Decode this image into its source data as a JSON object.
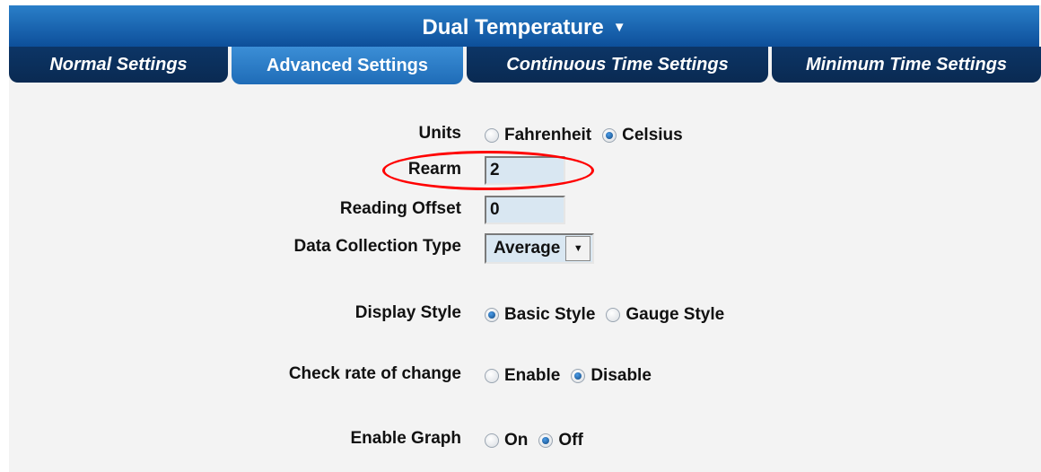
{
  "header": {
    "title": "Dual Temperature",
    "caret": "▼"
  },
  "tabs": [
    {
      "label": "Normal Settings"
    },
    {
      "label": "Advanced Settings"
    },
    {
      "label": "Continuous Time Settings"
    },
    {
      "label": "Minimum Time Settings"
    }
  ],
  "active_tab": "Advanced Settings",
  "form": {
    "units": {
      "label": "Units",
      "options": [
        "Fahrenheit",
        "Celsius"
      ],
      "selected": "Celsius"
    },
    "rearm": {
      "label": "Rearm",
      "value": "2"
    },
    "reading_offset": {
      "label": "Reading Offset",
      "value": "0"
    },
    "data_collection_type": {
      "label": "Data Collection Type",
      "value": "Average"
    },
    "display_style": {
      "label": "Display Style",
      "options": [
        "Basic Style",
        "Gauge Style"
      ],
      "selected": "Basic Style"
    },
    "check_rate_of_change": {
      "label": "Check rate of change",
      "options": [
        "Enable",
        "Disable"
      ],
      "selected": "Disable"
    },
    "enable_graph": {
      "label": "Enable Graph",
      "options": [
        "On",
        "Off"
      ],
      "selected": "Off"
    }
  },
  "colors": {
    "header_blue": "#1667b4",
    "tab_dark": "#0c3566",
    "tab_active": "#2a7fc9",
    "field_bg": "#d9e7f2",
    "highlight_circle": "#ff0000"
  }
}
